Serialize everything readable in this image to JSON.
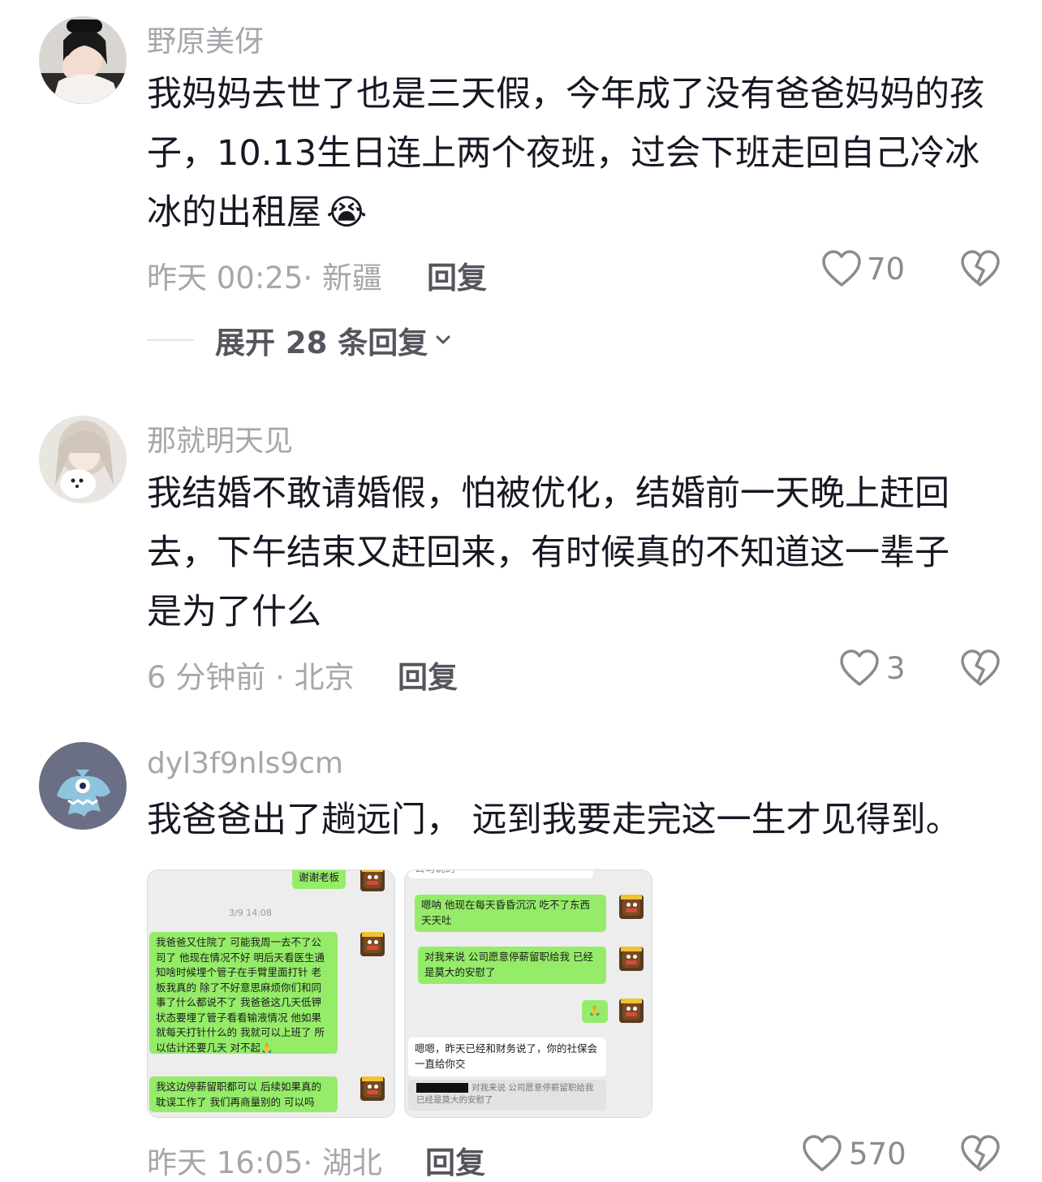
{
  "comments": [
    {
      "username": "野原美伢",
      "text": "我妈妈去世了也是三天假，今年成了没有爸爸妈妈的孩子，10.13生日连上两个夜班，过会下班走回自己冷冰冰的出租屋",
      "emoji": "😭",
      "meta": "昨天 00:25· 新疆",
      "reply_label": "回复",
      "likes": "70",
      "expand_label": "展开 28 条回复"
    },
    {
      "username": "那就明天见",
      "text_lines": [
        "我结婚不敢请婚假，怕被优化，结婚前一天晚上赶回",
        "去，下午结束又赶回来，有时候真的不知道这一辈子",
        "是为了什么"
      ],
      "meta": "6 分钟前 · 北京",
      "reply_label": "回复",
      "likes": "3"
    },
    {
      "username": "dyl3f9nls9cm",
      "text": "我爸爸出了趟远门， 远到我要走完这一生才见得到。",
      "meta": "昨天 16:05· 湖北",
      "reply_label": "回复",
      "likes": "570",
      "screenshot1": {
        "top_bubble": "谢谢老板",
        "timestamp": "3/9 14:08",
        "msg1": "我爸爸又住院了 可能我周一去不了公司了 他现在情况不好 明后天看医生通知啥时候埋个管子在手臂里面打针 老板我真的 除了不好意思麻烦你们和同事了什么都说不了 我爸爸这几天低钾状态要埋了管子看看输液情况 他如果就每天打针什么的 我就可以上班了 所以估计还要几天 对不起🙏",
        "msg2": "我这边停薪留职都可以 后续如果真的耽误工作了 我们再商量别的 可以吗"
      },
      "screenshot2": {
        "top_cut": "公司说的",
        "msg1": "嗯呐 他现在每天昏昏沉沉 吃不了东西 天天吐",
        "msg2": "对我来说 公司愿意停薪留职给我 已经是莫大的安慰了",
        "msg3": "🙏",
        "reply_msg": "嗯嗯，昨天已经和财务说了，你的社保会一直给你交",
        "quote": "对我来说 公司愿意停薪留职给我 已经是莫大的安慰了"
      }
    }
  ]
}
